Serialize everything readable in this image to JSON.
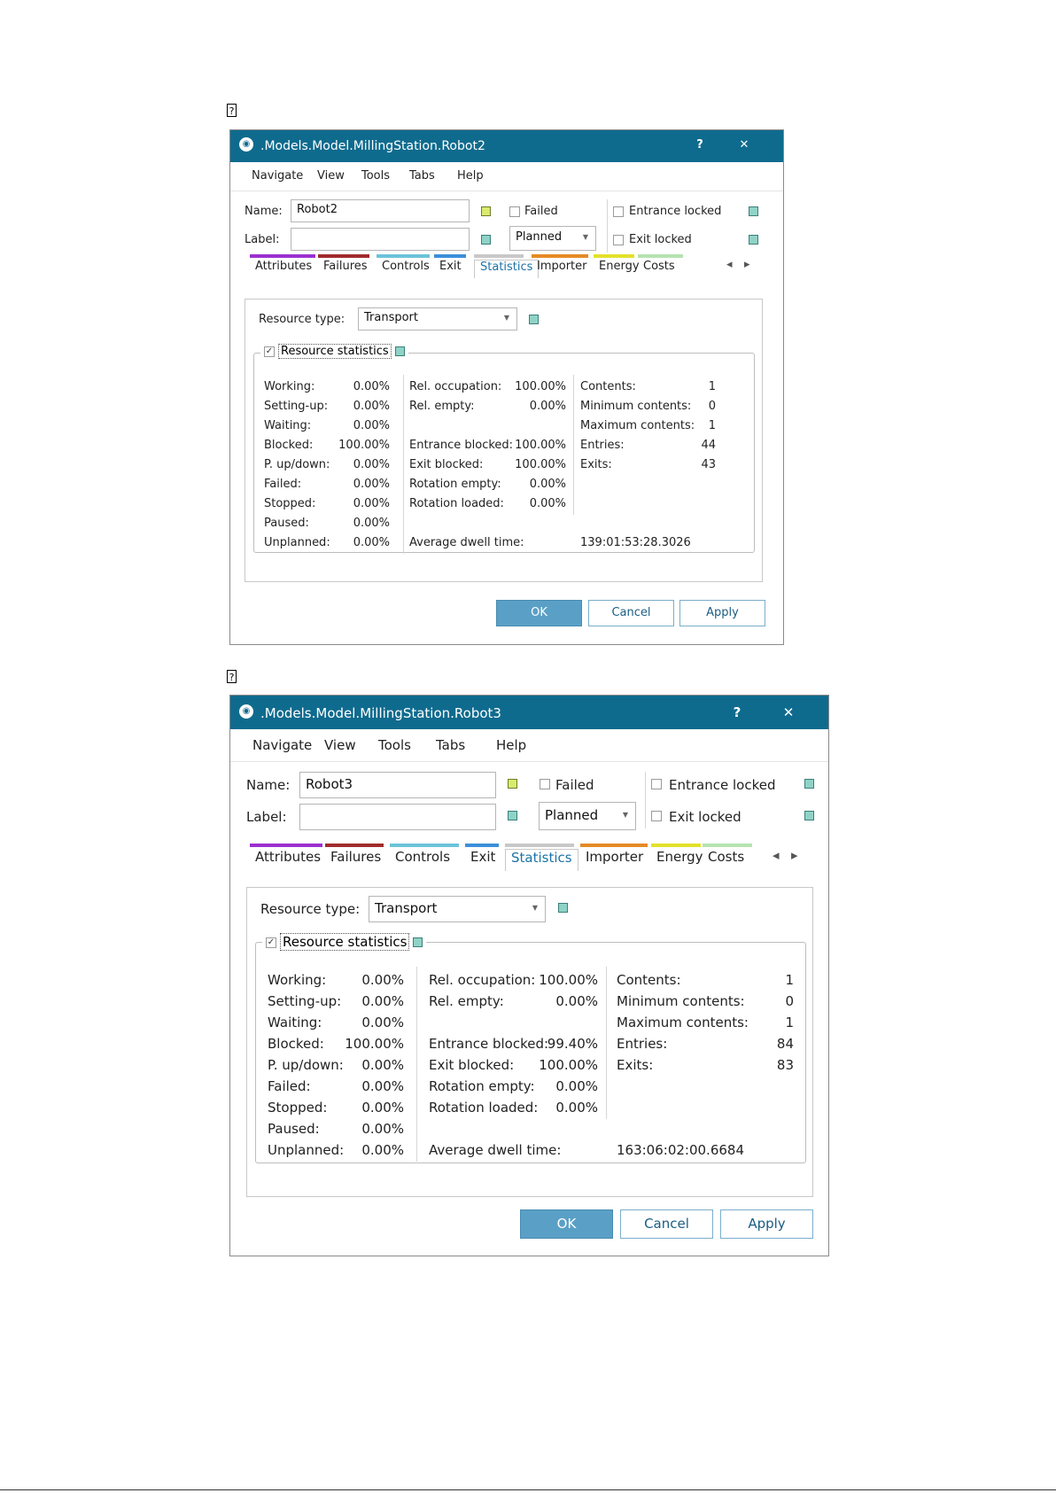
{
  "markers": [
    "?",
    "?"
  ],
  "dialogs": [
    {
      "title": ".Models.Model.MillingStation.Robot2",
      "help_btn": "?",
      "close_btn": "✕",
      "menu": [
        "Navigate",
        "View",
        "Tools",
        "Tabs",
        "Help"
      ],
      "name_label": "Name:",
      "name_value": "Robot2",
      "label_label": "Label:",
      "label_value": "",
      "failed_label": "Failed",
      "failed_checked": false,
      "planned_value": "Planned",
      "entrance_locked_label": "Entrance locked",
      "exit_locked_label": "Exit locked",
      "tabs": [
        {
          "label": "Attributes",
          "color": "#9b2fcf"
        },
        {
          "label": "Failures",
          "color": "#a12b2b"
        },
        {
          "label": "Controls",
          "color": "#6cc3d9"
        },
        {
          "label": "Exit",
          "color": "#3b8fd9"
        },
        {
          "label": "Statistics",
          "color": "#c8c8c8",
          "active": true
        },
        {
          "label": "Importer",
          "color": "#e58a25"
        },
        {
          "label": "Energy",
          "color": "#e3e12a"
        },
        {
          "label": "Costs",
          "color": "#b5e3b0"
        }
      ],
      "nav_left": "◂",
      "nav_right": "▸",
      "resource_type_label": "Resource type:",
      "resource_type_value": "Transport",
      "resource_statistics_label": "Resource statistics",
      "resource_statistics_checked": true,
      "col1": [
        {
          "label": "Working:",
          "value": "0.00%"
        },
        {
          "label": "Setting-up:",
          "value": "0.00%"
        },
        {
          "label": "Waiting:",
          "value": "0.00%"
        },
        {
          "label": "Blocked:",
          "value": "100.00%"
        },
        {
          "label": "P. up/down:",
          "value": "0.00%"
        },
        {
          "label": "Failed:",
          "value": "0.00%"
        },
        {
          "label": "Stopped:",
          "value": "0.00%"
        },
        {
          "label": "Paused:",
          "value": "0.00%"
        },
        {
          "label": "Unplanned:",
          "value": "0.00%"
        }
      ],
      "col2": [
        {
          "label": "Rel. occupation:",
          "value": "100.00%",
          "row": 0
        },
        {
          "label": "Rel. empty:",
          "value": "0.00%",
          "row": 1
        },
        {
          "label": "Entrance blocked:",
          "value": "100.00%",
          "row": 3
        },
        {
          "label": "Exit blocked:",
          "value": "100.00%",
          "row": 4
        },
        {
          "label": "Rotation empty:",
          "value": "0.00%",
          "row": 5
        },
        {
          "label": "Rotation loaded:",
          "value": "0.00%",
          "row": 6
        }
      ],
      "col3": [
        {
          "label": "Contents:",
          "value": "1",
          "row": 0
        },
        {
          "label": "Minimum contents:",
          "value": "0",
          "row": 1
        },
        {
          "label": "Maximum contents:",
          "value": "1",
          "row": 2
        },
        {
          "label": "Entries:",
          "value": "44",
          "row": 3
        },
        {
          "label": "Exits:",
          "value": "43",
          "row": 4
        }
      ],
      "avg_dwell_label": "Average dwell time:",
      "avg_dwell_value": "139:01:53:28.3026",
      "ok": "OK",
      "cancel": "Cancel",
      "apply": "Apply"
    },
    {
      "title": ".Models.Model.MillingStation.Robot3",
      "help_btn": "?",
      "close_btn": "✕",
      "menu": [
        "Navigate",
        "View",
        "Tools",
        "Tabs",
        "Help"
      ],
      "name_label": "Name:",
      "name_value": "Robot3",
      "label_label": "Label:",
      "label_value": "",
      "failed_label": "Failed",
      "failed_checked": false,
      "planned_value": "Planned",
      "entrance_locked_label": "Entrance locked",
      "exit_locked_label": "Exit locked",
      "tabs": [
        {
          "label": "Attributes",
          "color": "#9b2fcf"
        },
        {
          "label": "Failures",
          "color": "#a12b2b"
        },
        {
          "label": "Controls",
          "color": "#6cc3d9"
        },
        {
          "label": "Exit",
          "color": "#3b8fd9"
        },
        {
          "label": "Statistics",
          "color": "#c8c8c8",
          "active": true
        },
        {
          "label": "Importer",
          "color": "#e58a25"
        },
        {
          "label": "Energy",
          "color": "#e3e12a"
        },
        {
          "label": "Costs",
          "color": "#b5e3b0"
        }
      ],
      "nav_left": "◂",
      "nav_right": "▸",
      "resource_type_label": "Resource type:",
      "resource_type_value": "Transport",
      "resource_statistics_label": "Resource statistics",
      "resource_statistics_checked": true,
      "col1": [
        {
          "label": "Working:",
          "value": "0.00%"
        },
        {
          "label": "Setting-up:",
          "value": "0.00%"
        },
        {
          "label": "Waiting:",
          "value": "0.00%"
        },
        {
          "label": "Blocked:",
          "value": "100.00%"
        },
        {
          "label": "P. up/down:",
          "value": "0.00%"
        },
        {
          "label": "Failed:",
          "value": "0.00%"
        },
        {
          "label": "Stopped:",
          "value": "0.00%"
        },
        {
          "label": "Paused:",
          "value": "0.00%"
        },
        {
          "label": "Unplanned:",
          "value": "0.00%"
        }
      ],
      "col2": [
        {
          "label": "Rel. occupation:",
          "value": "100.00%",
          "row": 0
        },
        {
          "label": "Rel. empty:",
          "value": "0.00%",
          "row": 1
        },
        {
          "label": "Entrance blocked:",
          "value": "99.40%",
          "row": 3
        },
        {
          "label": "Exit blocked:",
          "value": "100.00%",
          "row": 4
        },
        {
          "label": "Rotation empty:",
          "value": "0.00%",
          "row": 5
        },
        {
          "label": "Rotation loaded:",
          "value": "0.00%",
          "row": 6
        }
      ],
      "col3": [
        {
          "label": "Contents:",
          "value": "1",
          "row": 0
        },
        {
          "label": "Minimum contents:",
          "value": "0",
          "row": 1
        },
        {
          "label": "Maximum contents:",
          "value": "1",
          "row": 2
        },
        {
          "label": "Entries:",
          "value": "84",
          "row": 3
        },
        {
          "label": "Exits:",
          "value": "83",
          "row": 4
        }
      ],
      "avg_dwell_label": "Average dwell time:",
      "avg_dwell_value": "163:06:02:00.6684",
      "ok": "OK",
      "cancel": "Cancel",
      "apply": "Apply"
    }
  ]
}
